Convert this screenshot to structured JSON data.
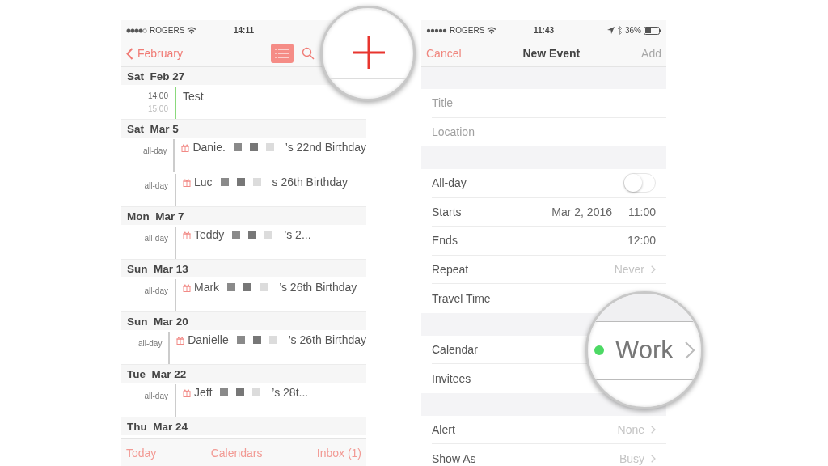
{
  "left_screen": {
    "status_bar": {
      "carrier": "ROGERS",
      "time": "14:11"
    },
    "nav": {
      "back": "February",
      "list_view_selected": true
    },
    "days": [
      {
        "date": "Sat  Feb 27",
        "events": [
          {
            "kind": "timed",
            "start": "14:00",
            "end": "15:00",
            "title": "Test",
            "color": "#8ad97c"
          }
        ]
      },
      {
        "date": "Sat  Mar 5",
        "events": [
          {
            "kind": "birthday",
            "time": "all-day",
            "name": "Danie.",
            "rest": "’s 22nd Birthday",
            "color": "#cccccc"
          },
          {
            "kind": "birthday",
            "time": "all-day",
            "name": "Luc",
            "rest": "s 26th Birthday",
            "color": "#cccccc"
          }
        ]
      },
      {
        "date": "Mon  Mar 7",
        "events": [
          {
            "kind": "birthday",
            "time": "all-day",
            "name": "Teddy",
            "rest": "’s 2...",
            "color": "#cccccc"
          }
        ]
      },
      {
        "date": "Sun  Mar 13",
        "events": [
          {
            "kind": "birthday",
            "time": "all-day",
            "name": "Mark",
            "rest": "’s 26th Birthday",
            "color": "#cccccc"
          }
        ]
      },
      {
        "date": "Sun  Mar 20",
        "events": [
          {
            "kind": "birthday",
            "time": "all-day",
            "name": "Danielle",
            "rest": "’s 26th Birthday",
            "color": "#cccccc"
          }
        ]
      },
      {
        "date": "Tue  Mar 22",
        "events": [
          {
            "kind": "birthday",
            "time": "all-day",
            "name": "Jeff",
            "rest": "’s 28t...",
            "color": "#cccccc"
          }
        ]
      },
      {
        "date": "Thu  Mar 24"
      }
    ],
    "toolbar": [
      "Today",
      "Calendars",
      "Inbox (1)"
    ]
  },
  "right_screen": {
    "status_bar": {
      "carrier": "ROGERS",
      "time": "11:43",
      "battery": "36%"
    },
    "nav": {
      "cancel": "Cancel",
      "title": "New Event",
      "add": "Add",
      "add_disabled": true
    },
    "sections": [
      {
        "rows": [
          {
            "kind": "input",
            "placeholder": "Title"
          },
          {
            "kind": "input",
            "placeholder": "Location"
          }
        ]
      },
      {
        "rows": [
          {
            "kind": "toggle",
            "label": "All-day",
            "on": false
          },
          {
            "kind": "value",
            "label": "Starts",
            "value": "Mar 2, 2016",
            "value_2": "11:00"
          },
          {
            "kind": "value",
            "label": "Ends",
            "value": "12:00"
          },
          {
            "kind": "link",
            "label": "Repeat",
            "value": "Never"
          },
          {
            "kind": "plain",
            "label": "Travel Time"
          }
        ]
      },
      {
        "rows": [
          {
            "kind": "plain",
            "label": "Calendar"
          },
          {
            "kind": "plain",
            "label": "Invitees"
          }
        ]
      },
      {
        "rows": [
          {
            "kind": "link",
            "label": "Alert",
            "value": "None"
          },
          {
            "kind": "link",
            "label": "Show As",
            "value": "Busy"
          }
        ]
      }
    ],
    "magnifier": {
      "calendar": "Work",
      "color": "#4cd964"
    }
  }
}
